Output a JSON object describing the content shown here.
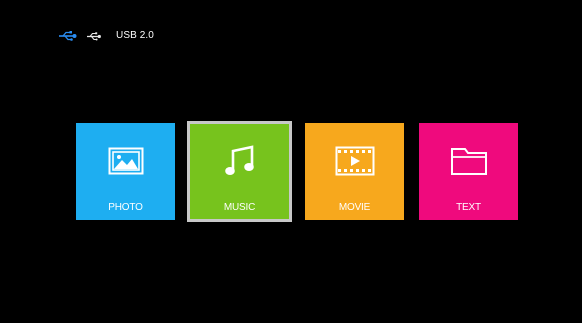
{
  "status": {
    "usb_label": "USB 2.0",
    "icons": [
      "usb-icon",
      "usb-icon"
    ]
  },
  "menu": {
    "selected": "MUSIC",
    "tiles": [
      {
        "label": "PHOTO",
        "icon": "photo-icon",
        "color": "#1eaef1"
      },
      {
        "label": "MUSIC",
        "icon": "music-note-icon",
        "color": "#77c31d"
      },
      {
        "label": "MOVIE",
        "icon": "film-play-icon",
        "color": "#f7a81d"
      },
      {
        "label": "TEXT",
        "icon": "folder-icon",
        "color": "#ef0a7d"
      }
    ]
  },
  "colors": {
    "background": "#000000",
    "selection_border": "#c8c8c8"
  }
}
